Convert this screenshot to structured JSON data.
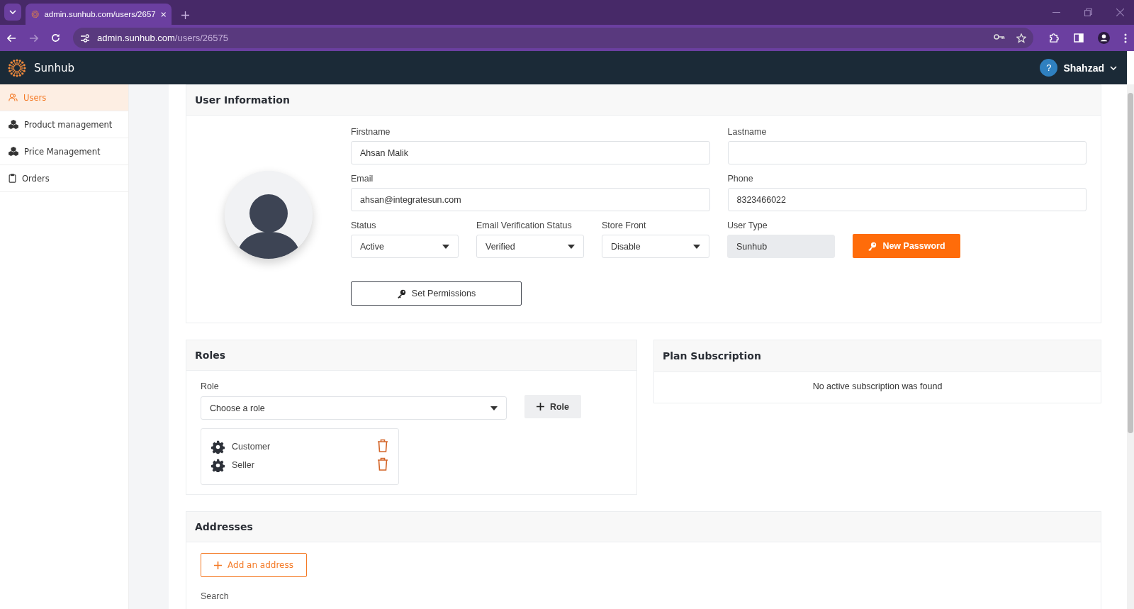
{
  "browser": {
    "tab_title": "admin.sunhub.com/users/2657",
    "url_host": "admin.sunhub.com",
    "url_path": "/users/26575"
  },
  "header": {
    "brand": "Sunhub",
    "help": "?",
    "user": "Shahzad"
  },
  "sidebar": {
    "items": [
      {
        "label": "Users",
        "kind": "users",
        "selected": true
      },
      {
        "label": "Product management",
        "kind": "products",
        "selected": false
      },
      {
        "label": "Price Management",
        "kind": "prices",
        "selected": false
      },
      {
        "label": "Orders",
        "kind": "orders",
        "selected": false
      }
    ]
  },
  "user_information": {
    "title": "User Information",
    "fields": [
      {
        "label": "Firstname",
        "kind": "text",
        "value": "Ahsan Malik"
      },
      {
        "label": "Lastname",
        "kind": "text"
      },
      {
        "label": "Email",
        "kind": "text",
        "value": "ahsan@integratesun.com"
      },
      {
        "label": "Phone",
        "kind": "text",
        "value": "8323466022"
      },
      {
        "label": "Status",
        "kind": "select",
        "value": "Active"
      },
      {
        "label": "Email Verification Status",
        "kind": "select",
        "value": "Verified"
      },
      {
        "label": "Store Front",
        "kind": "select",
        "value": "Disable"
      },
      {
        "label": "User Type",
        "kind": "readonly",
        "value": "Sunhub"
      }
    ],
    "new_password_button": "New Password",
    "set_permissions_button": "Set Permissions"
  },
  "roles": {
    "title": "Roles",
    "role_label": "Role",
    "role_select": "Choose a role",
    "add_role_button": "Role",
    "items": [
      {
        "name": "Customer"
      },
      {
        "name": "Seller"
      }
    ]
  },
  "plan_subscription": {
    "title": "Plan Subscription",
    "message": "No active subscription was found"
  },
  "addresses": {
    "title": "Addresses",
    "add_button": "Add an address",
    "search_label": "Search"
  }
}
